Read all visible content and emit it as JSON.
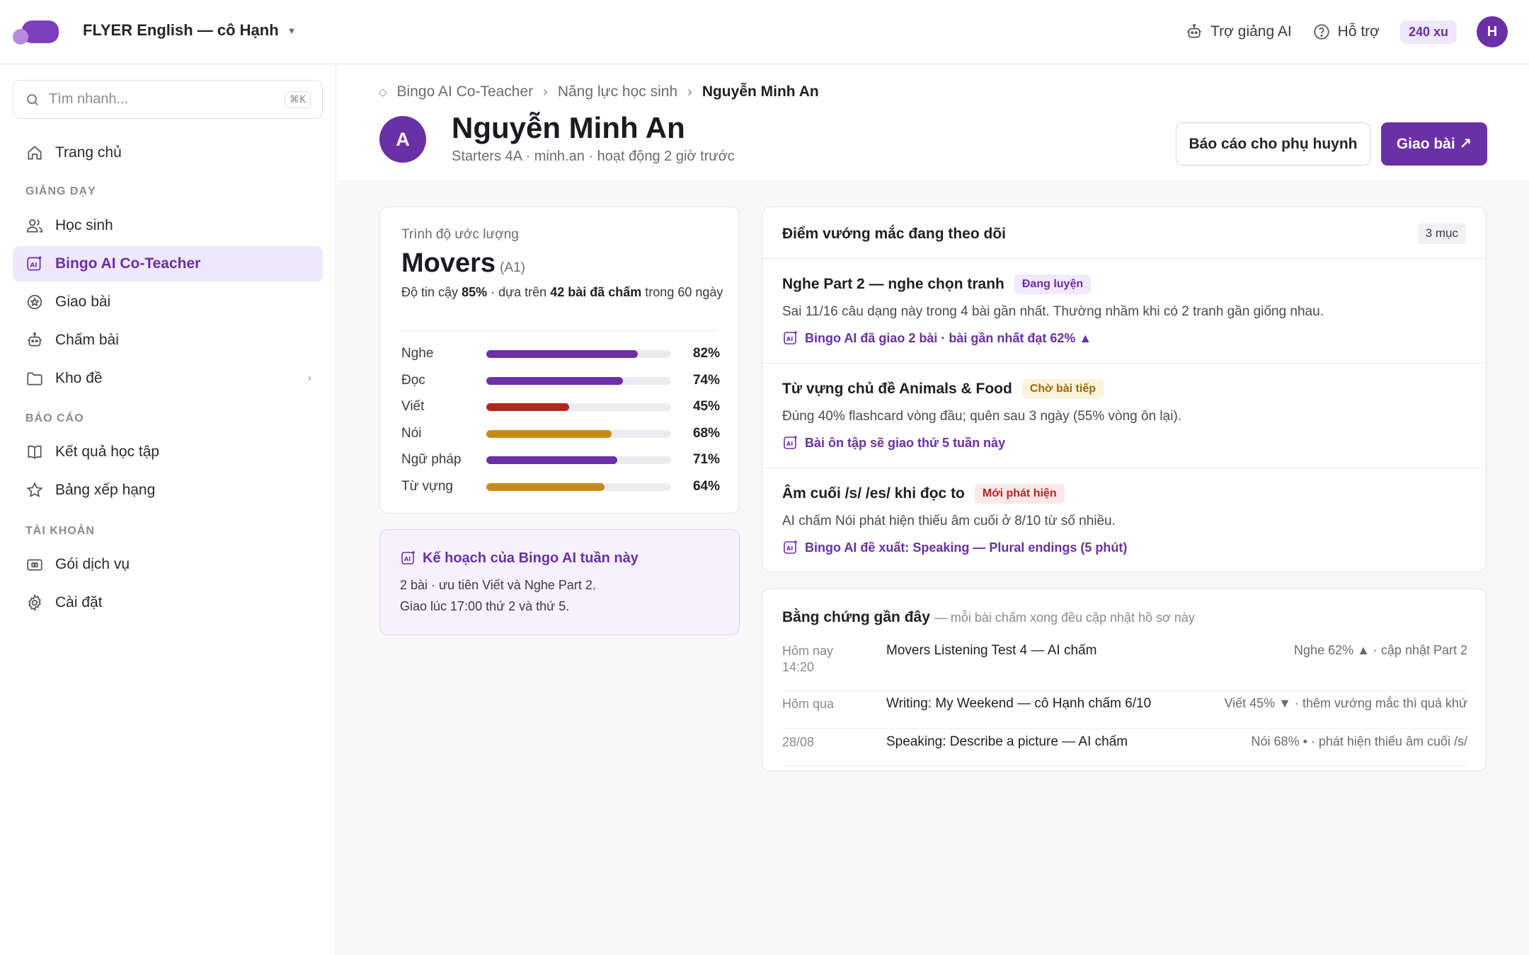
{
  "header": {
    "workspace": "FLYER English — cô Hạnh",
    "assistant_label": "Trợ giảng AI",
    "support_label": "Hỗ trợ",
    "coins": "240 xu",
    "user_initial": "H"
  },
  "sidebar": {
    "search_placeholder": "Tìm nhanh...",
    "search_shortcut": "⌘K",
    "home": "Trang chủ",
    "section_teaching": "GIẢNG DẠY",
    "students": "Học sinh",
    "co_teacher": "Bingo AI Co-Teacher",
    "assign": "Giao bài",
    "grading": "Chấm bài",
    "bank": "Kho đề",
    "section_reports": "BÁO CÁO",
    "results": "Kết quả học tập",
    "ranking": "Bảng xếp hạng",
    "section_account": "TÀI KHOẢN",
    "plans": "Gói dịch vụ",
    "settings": "Cài đặt"
  },
  "breadcrumb": {
    "root": "Bingo AI Co-Teacher",
    "middle": "Năng lực học sinh",
    "current": "Nguyễn Minh An"
  },
  "student": {
    "initial": "A",
    "name": "Nguyễn Minh An",
    "meta": "Starters 4A · minh.an · hoạt động 2 giờ trước"
  },
  "actions": {
    "report_parents": "Báo cáo cho phụ huynh",
    "assign": "Giao bài ↗"
  },
  "level": {
    "label": "Trình độ ước lượng",
    "value": "Movers",
    "cefr": "(A1)",
    "conf_prefix": "Độ tin cậy",
    "conf_value": "85%",
    "conf_mid": "· dựa trên",
    "conf_count": "42 bài đã chấm",
    "conf_suffix": "trong 60 ngày",
    "skills": [
      {
        "name": "Nghe",
        "value": 82,
        "label": "82%",
        "color": "#6b2fa6"
      },
      {
        "name": "Đọc",
        "value": 74,
        "label": "74%",
        "color": "#6b2fa6"
      },
      {
        "name": "Viết",
        "value": 45,
        "label": "45%",
        "color": "#b2261e"
      },
      {
        "name": "Nói",
        "value": 68,
        "label": "68%",
        "color": "#c9891a"
      },
      {
        "name": "Ngữ pháp",
        "value": 71,
        "label": "71%",
        "color": "#6b2fa6"
      },
      {
        "name": "Từ vựng",
        "value": 64,
        "label": "64%",
        "color": "#c9891a"
      }
    ]
  },
  "plan": {
    "title": "Kế hoạch của Bingo AI tuần này",
    "line1": "2 bài · ưu tiên Viết và Nghe Part 2.",
    "line2": "Giao lúc 17:00 thứ 2 và thứ 5."
  },
  "obstacles": {
    "title": "Điểm vướng mắc đang theo dõi",
    "count": "3 mục",
    "items": [
      {
        "title": "Nghe Part 2 — nghe chọn tranh",
        "tag": "Đang luyện",
        "desc": "Sai 11/16 câu dạng này trong 4 bài gần nhất. Thường nhầm khi có 2 tranh gần giống nhau.",
        "ai": "Bingo AI đã giao 2 bài · bài gần nhất đạt 62% ▲"
      },
      {
        "title": "Từ vựng chủ đề Animals & Food",
        "tag": "Chờ bài tiếp",
        "desc": "Đúng 40% flashcard vòng đầu; quên sau 3 ngày (55% vòng ôn lại).",
        "ai": "Bài ôn tập sẽ giao thứ 5 tuần này"
      },
      {
        "title": "Âm cuối /s/ /es/ khi đọc to",
        "tag": "Mới phát hiện",
        "desc": "AI chấm Nói phát hiện thiếu âm cuối ở 8/10 từ số nhiều.",
        "ai": "Bingo AI đề xuất: Speaking — Plural endings (5 phút)"
      }
    ]
  },
  "evidence": {
    "title": "Bằng chứng gần đây",
    "subtitle": "— mỗi bài chấm xong đều cập nhật hồ sơ này",
    "rows": [
      {
        "date": "Hôm nay 14:20",
        "name": "Movers Listening Test 4 — AI chấm",
        "result": "Nghe 62% ▲ · cập nhật Part 2"
      },
      {
        "date": "Hôm qua",
        "name": "Writing: My Weekend — cô Hạnh chấm 6/10",
        "result": "Viết 45% ▼ · thêm vướng mắc thì quá khứ"
      },
      {
        "date": "28/08",
        "name": "Speaking: Describe a picture — AI chấm",
        "result": "Nói 68% • · phát hiện thiếu âm cuối /s/"
      }
    ]
  },
  "colors": {
    "accent": "#6b2fa6",
    "warning": "#c9891a",
    "danger": "#b2261e"
  },
  "icons": [
    "logo",
    "robot-icon",
    "help-icon",
    "search-icon",
    "home-icon",
    "users-icon",
    "ai-icon",
    "badge-icon",
    "robot-icon",
    "folder-icon",
    "book-icon",
    "star-icon",
    "wallet-icon",
    "gear-icon"
  ]
}
